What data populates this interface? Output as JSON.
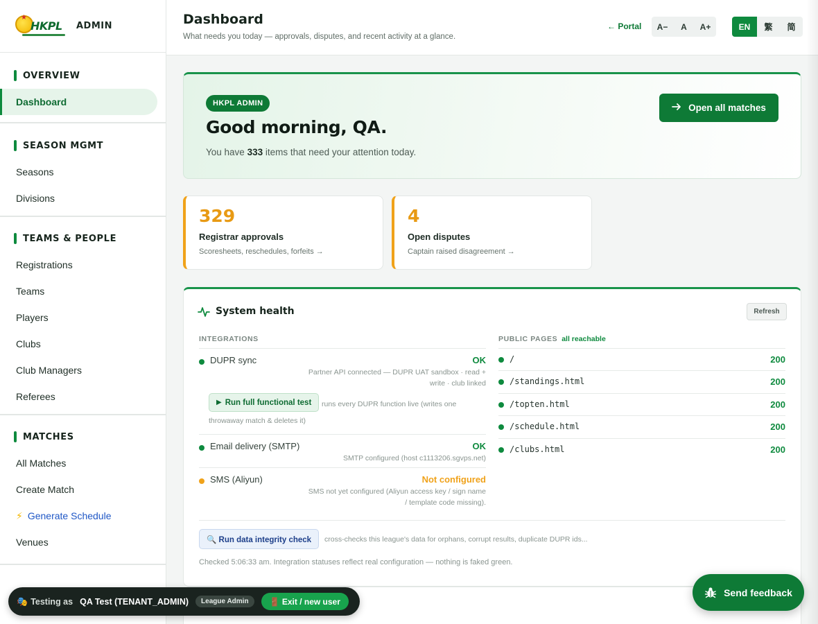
{
  "brand": {
    "logo_text": "HKPL",
    "title": "ADMIN"
  },
  "sidebar": {
    "sections": [
      {
        "title": "OVERVIEW",
        "items": [
          "Dashboard"
        ]
      },
      {
        "title": "SEASON MGMT",
        "items": [
          "Seasons",
          "Divisions"
        ]
      },
      {
        "title": "TEAMS & PEOPLE",
        "items": [
          "Registrations",
          "Teams",
          "Players",
          "Clubs",
          "Club Managers",
          "Referees"
        ]
      },
      {
        "title": "MATCHES",
        "items": [
          "All Matches",
          "Create Match",
          "Generate Schedule",
          "Venues"
        ]
      }
    ],
    "active_item": "Dashboard"
  },
  "header": {
    "title": "Dashboard",
    "subtitle": "What needs you today — approvals, disputes, and recent activity at a glance.",
    "portal_link": "← Portal",
    "font_sizes": [
      "A−",
      "A",
      "A+"
    ],
    "languages": [
      "EN",
      "繁",
      "简"
    ],
    "active_language": "EN"
  },
  "hero": {
    "badge": "HKPL ADMIN",
    "greeting": "Good morning, QA.",
    "text_before": "You have ",
    "count": "333",
    "text_after": " items that need your attention today.",
    "button": "Open all matches"
  },
  "stats": [
    {
      "value": "329",
      "label": "Registrar approvals",
      "sub": "Scoresheets, reschedules, forfeits →"
    },
    {
      "value": "4",
      "label": "Open disputes",
      "sub": "Captain raised disagreement →"
    }
  ],
  "health": {
    "title": "System health",
    "refresh": "Refresh",
    "integrations_heading": "INTEGRATIONS",
    "public_heading": "PUBLIC PAGES",
    "public_note": "all reachable",
    "integrations": [
      {
        "name": "DUPR sync",
        "status": "OK",
        "desc": "Partner API connected — DUPR UAT sandbox · read + write · club linked"
      },
      {
        "name": "Email delivery (SMTP)",
        "status": "OK",
        "desc": "SMTP configured (host c1113206.sgvps.net)"
      },
      {
        "name": "SMS (Aliyun)",
        "status": "Not configured",
        "desc": "SMS not yet configured (Aliyun access key / sign name / template code missing)."
      }
    ],
    "run_test": "Run full functional test",
    "run_test_note": "runs every DUPR function live (writes one throwaway match & deletes it)",
    "pages": [
      {
        "path": "/",
        "code": "200"
      },
      {
        "path": "/standings.html",
        "code": "200"
      },
      {
        "path": "/topten.html",
        "code": "200"
      },
      {
        "path": "/schedule.html",
        "code": "200"
      },
      {
        "path": "/clubs.html",
        "code": "200"
      }
    ],
    "integrity_button": "🔍 Run data integrity check",
    "integrity_note": "cross-checks this league's data for orphans, corrupt results, duplicate DUPR ids...",
    "checked_note": "Checked 5:06:33 am. Integration statuses reflect real configuration — nothing is faked green."
  },
  "testing_bar": {
    "label": "Testing as",
    "user": "QA Test (TENANT_ADMIN)",
    "role": "League Admin",
    "exit": "🚪 Exit / new user"
  },
  "feedback": {
    "label": "Send feedback"
  },
  "colors": {
    "primary": "#0e7a36",
    "ok": "#0e8a3e",
    "warn": "#f0a21a",
    "link": "#1f57c6"
  }
}
